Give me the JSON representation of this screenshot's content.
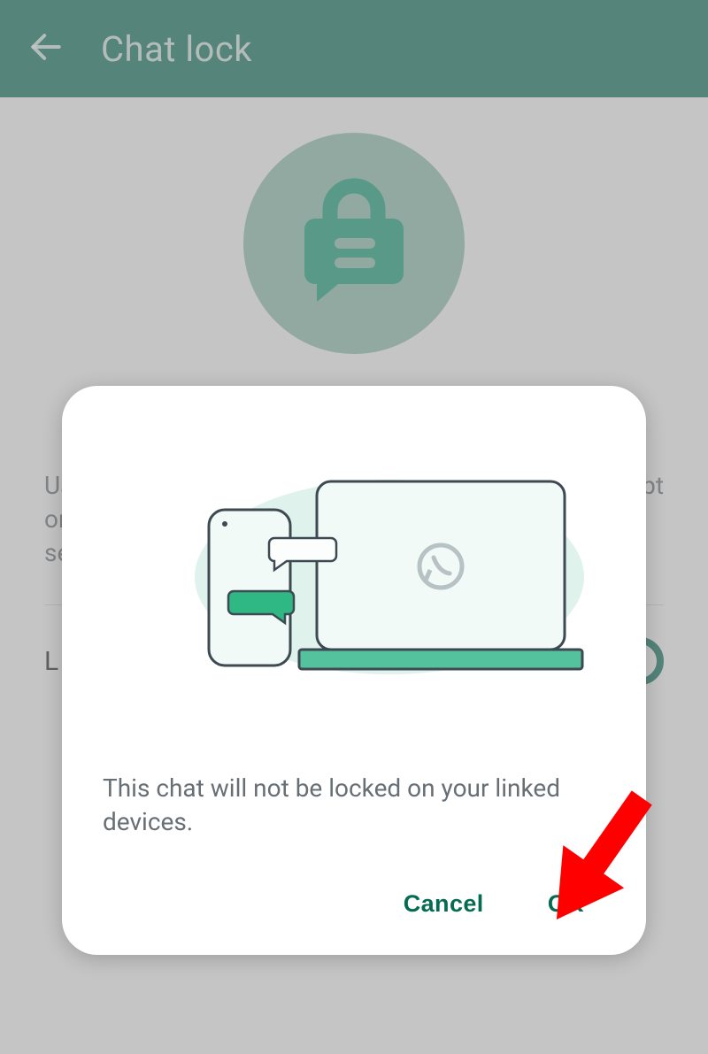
{
  "appbar": {
    "title": "Chat lock"
  },
  "page": {
    "description_line1": "Us",
    "description_line2": "or",
    "description_line3": "se",
    "description_trail": "pt",
    "toggle_label_prefix": "L"
  },
  "dialog": {
    "message": "This chat will not be locked on your linked devices.",
    "cancel_label": "Cancel",
    "ok_label": "OK"
  }
}
